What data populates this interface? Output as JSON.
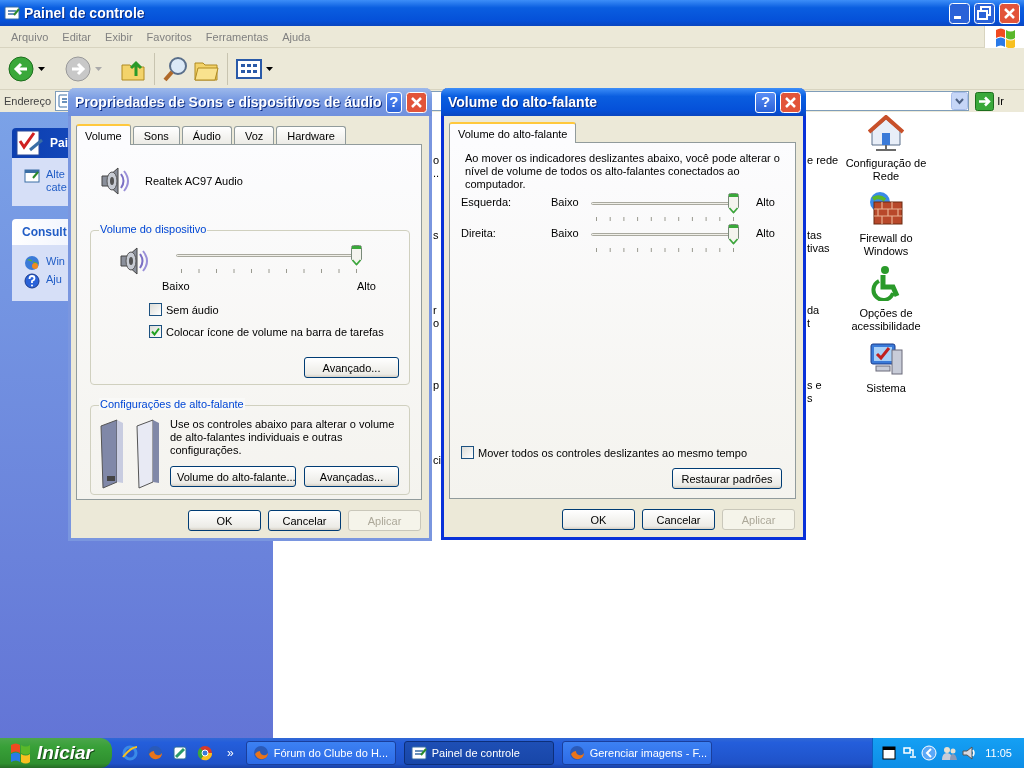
{
  "control_panel": {
    "title": "Painel de controle",
    "menu": [
      "Arquivo",
      "Editar",
      "Exibir",
      "Favoritos",
      "Ferramentas",
      "Ajuda"
    ],
    "address_label": "Endereço",
    "go_label": "Ir",
    "task_boxes": [
      {
        "header": "Pai",
        "kind": "main",
        "items": [
          {
            "lines": [
              "Alte",
              "cate"
            ]
          }
        ]
      },
      {
        "header": "Consult",
        "kind": "plain",
        "items": [
          {
            "lines": [
              "Win"
            ]
          },
          {
            "lines": [
              "Aju"
            ]
          }
        ]
      }
    ],
    "clipped_middle": [
      [
        "o",
        ".."
      ],
      [
        "s"
      ],
      [
        "r",
        "o"
      ],
      [
        "p"
      ],
      [
        "ci"
      ]
    ],
    "clipped_right": [
      [
        "e rede"
      ],
      [
        "tas",
        "tivas"
      ],
      [
        "da",
        "t"
      ],
      [
        "s e",
        "s"
      ]
    ],
    "icons": [
      {
        "label": "Configuração de Rede"
      },
      {
        "label": "Firewall do Windows"
      },
      {
        "label": "Opções de acessibilidade"
      },
      {
        "label": "Sistema"
      }
    ]
  },
  "sound_dialog": {
    "title": "Propriedades de Sons e dispositivos de áudio",
    "active": false,
    "help": "?",
    "tabs": [
      {
        "label": "Volume",
        "selected": true
      },
      {
        "label": "Sons",
        "selected": false
      },
      {
        "label": "Áudio",
        "selected": false
      },
      {
        "label": "Voz",
        "selected": false
      },
      {
        "label": "Hardware",
        "selected": false
      }
    ],
    "device_name": "Realtek AC97 Audio",
    "device_volume": {
      "legend": "Volume do dispositivo",
      "level": 1.0,
      "low_label": "Baixo",
      "high_label": "Alto"
    },
    "options": [
      {
        "label": "Sem áudio",
        "checked": false
      },
      {
        "label": "Colocar ícone de volume na barra de tarefas",
        "checked": true
      }
    ],
    "advanced_button": "Avançado...",
    "speaker_settings": {
      "legend": "Configurações de alto-falante",
      "description": "Use os controles abaixo para alterar o volume de alto-falantes individuais e outras configurações.",
      "buttons": [
        "Volume do alto-falante...",
        "Avançadas..."
      ]
    },
    "buttons": [
      {
        "label": "OK",
        "disabled": false
      },
      {
        "label": "Cancelar",
        "disabled": false
      },
      {
        "label": "Aplicar",
        "disabled": true
      }
    ]
  },
  "speaker_dialog": {
    "title": "Volume do alto-falante",
    "active": true,
    "help": "?",
    "tabs": [
      {
        "label": "Volume do alto-falante",
        "selected": true
      }
    ],
    "description": "Ao mover os indicadores deslizantes abaixo, você pode alterar o nível de volume de todos os alto-falantes conectados ao computador.",
    "channels": [
      {
        "name": "Esquerda:",
        "low_label": "Baixo",
        "high_label": "Alto",
        "level": 1.0
      },
      {
        "name": "Direita:",
        "low_label": "Baixo",
        "high_label": "Alto",
        "level": 1.0
      }
    ],
    "sync_option": {
      "label": "Mover todos os controles deslizantes ao mesmo tempo",
      "checked": false
    },
    "restore_button": "Restaurar padrões",
    "buttons": [
      {
        "label": "OK",
        "disabled": false
      },
      {
        "label": "Cancelar",
        "disabled": false
      },
      {
        "label": "Aplicar",
        "disabled": true
      }
    ]
  },
  "taskbar": {
    "start": "Iniciar",
    "chevron": "»",
    "tasks": [
      {
        "label": "Fórum do Clube do H...",
        "selected": false
      },
      {
        "label": "Painel de controle",
        "selected": true
      },
      {
        "label": "Gerenciar imagens - F...",
        "selected": false
      }
    ],
    "clock": "11:05"
  }
}
